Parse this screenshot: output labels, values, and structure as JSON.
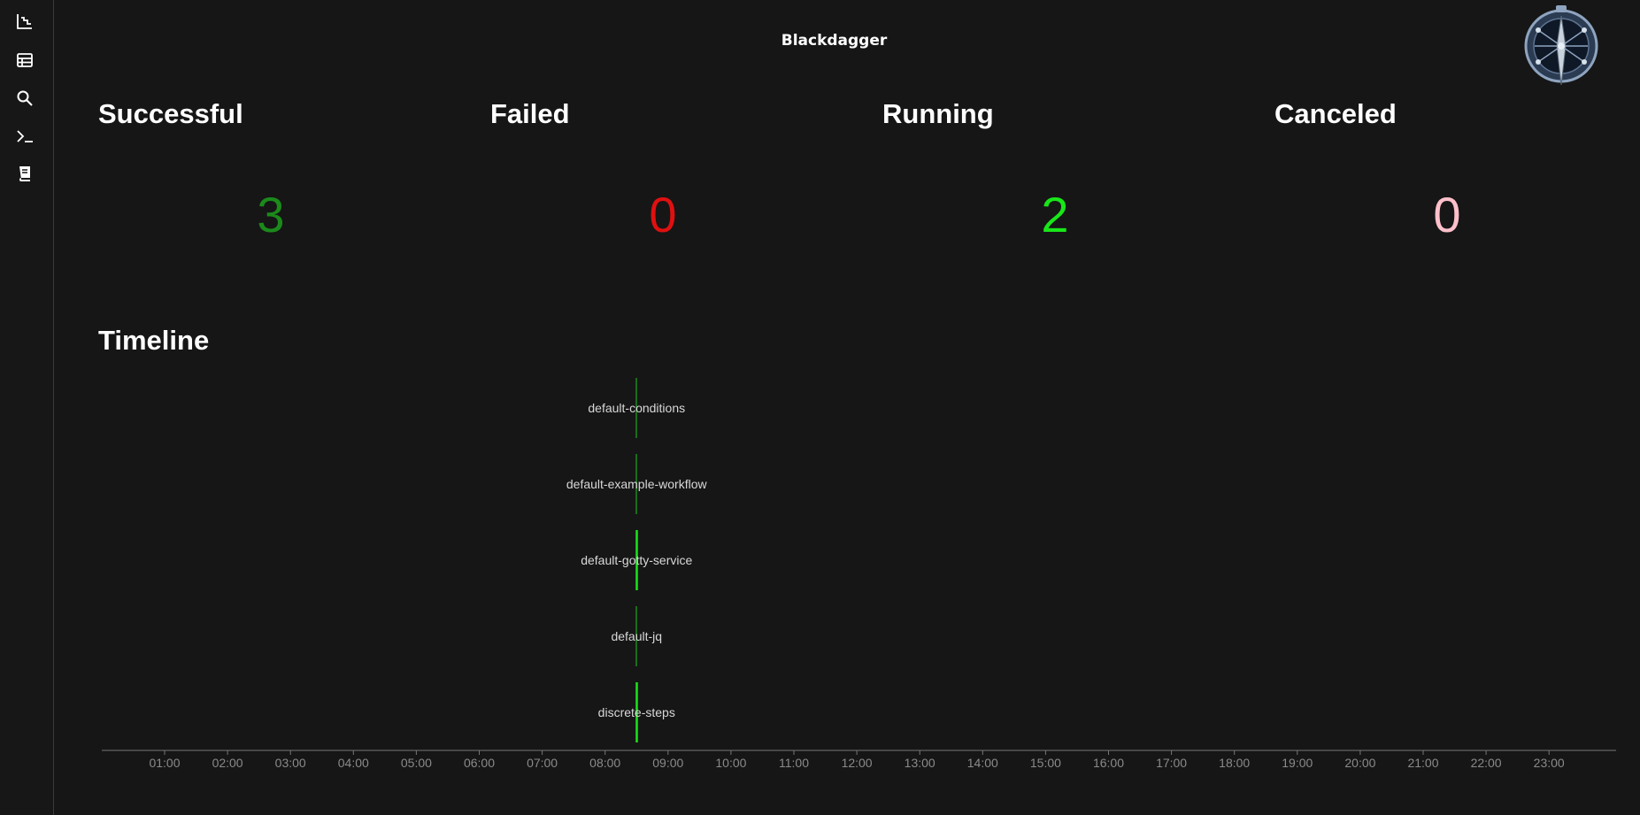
{
  "app": {
    "title": "Blackdagger"
  },
  "sidebar": {
    "items": [
      {
        "icon": "chart-icon",
        "label": ""
      },
      {
        "icon": "table-icon",
        "label": ""
      },
      {
        "icon": "search-icon",
        "label": ""
      },
      {
        "icon": "terminal-icon",
        "label": ""
      },
      {
        "icon": "book-icon",
        "label": ""
      }
    ]
  },
  "stats": [
    {
      "label": "Successful",
      "value": "3",
      "color": "#1b8a1b"
    },
    {
      "label": "Failed",
      "value": "0",
      "color": "#e01010"
    },
    {
      "label": "Running",
      "value": "2",
      "color": "#19e619"
    },
    {
      "label": "Canceled",
      "value": "0",
      "color": "#ffc0cb"
    }
  ],
  "timeline": {
    "title": "Timeline",
    "chart_data": {
      "type": "timeline",
      "x_ticks": [
        "01:00",
        "02:00",
        "03:00",
        "04:00",
        "05:00",
        "06:00",
        "07:00",
        "08:00",
        "09:00",
        "10:00",
        "11:00",
        "12:00",
        "13:00",
        "14:00",
        "15:00",
        "16:00",
        "17:00",
        "18:00",
        "19:00",
        "20:00",
        "21:00",
        "22:00",
        "23:00"
      ],
      "xlim": [
        "00:15",
        "24:00"
      ],
      "rows": [
        {
          "name": "default-conditions",
          "time": "08:30",
          "status": "successful",
          "color": "#1b8a1b"
        },
        {
          "name": "default-example-workflow",
          "time": "08:30",
          "status": "successful",
          "color": "#1b8a1b"
        },
        {
          "name": "default-gotty-service",
          "time": "08:30",
          "status": "running",
          "color": "#19e619"
        },
        {
          "name": "default-jq",
          "time": "08:30",
          "status": "successful",
          "color": "#1b8a1b"
        },
        {
          "name": "discrete-steps",
          "time": "08:30",
          "status": "running",
          "color": "#19e619"
        }
      ]
    }
  }
}
